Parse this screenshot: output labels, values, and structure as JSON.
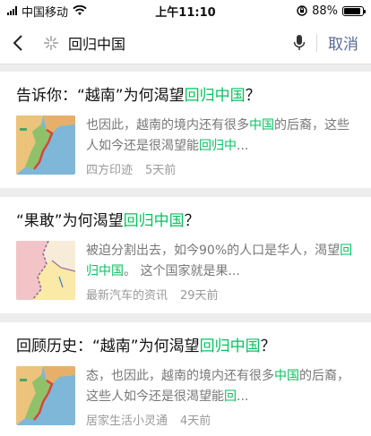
{
  "status_bar": {
    "carrier": "中国移动",
    "time": "上午11:10",
    "battery": "88%",
    "battery_level": 0.88
  },
  "search": {
    "query": "回归中国",
    "cancel_label": "取消"
  },
  "results": [
    {
      "title": [
        "告诉你：“越南”为何渴望",
        "回归中国",
        "？"
      ],
      "snippet": [
        "也因此，越南的境内还有很多",
        "中国",
        "的后裔，这些人如今还是很渴望能",
        "回归中",
        "..."
      ],
      "source": "四方印迹",
      "age": "5天前",
      "thumb": "vietnam-map"
    },
    {
      "title": [
        "“果敢”为何渴望",
        "回归中国",
        "？"
      ],
      "snippet": [
        "被迫分割出去，如今90%的人口是华人，渴望",
        "回归中国",
        "。 这个国家就是果...",
        "",
        ""
      ],
      "source": "最新汽车的资讯",
      "age": "29天前",
      "thumb": "kokang-map"
    },
    {
      "title": [
        "回顾历史：“越南”为何渴望",
        "回归中国",
        "？"
      ],
      "snippet": [
        "态，也因此，越南的境内还有很多",
        "中国",
        "的后裔，这些人如今还是很渴望能",
        "回",
        "..."
      ],
      "source": "居家生活小灵通",
      "age": "4天前",
      "thumb": "vietnam-map"
    }
  ]
}
